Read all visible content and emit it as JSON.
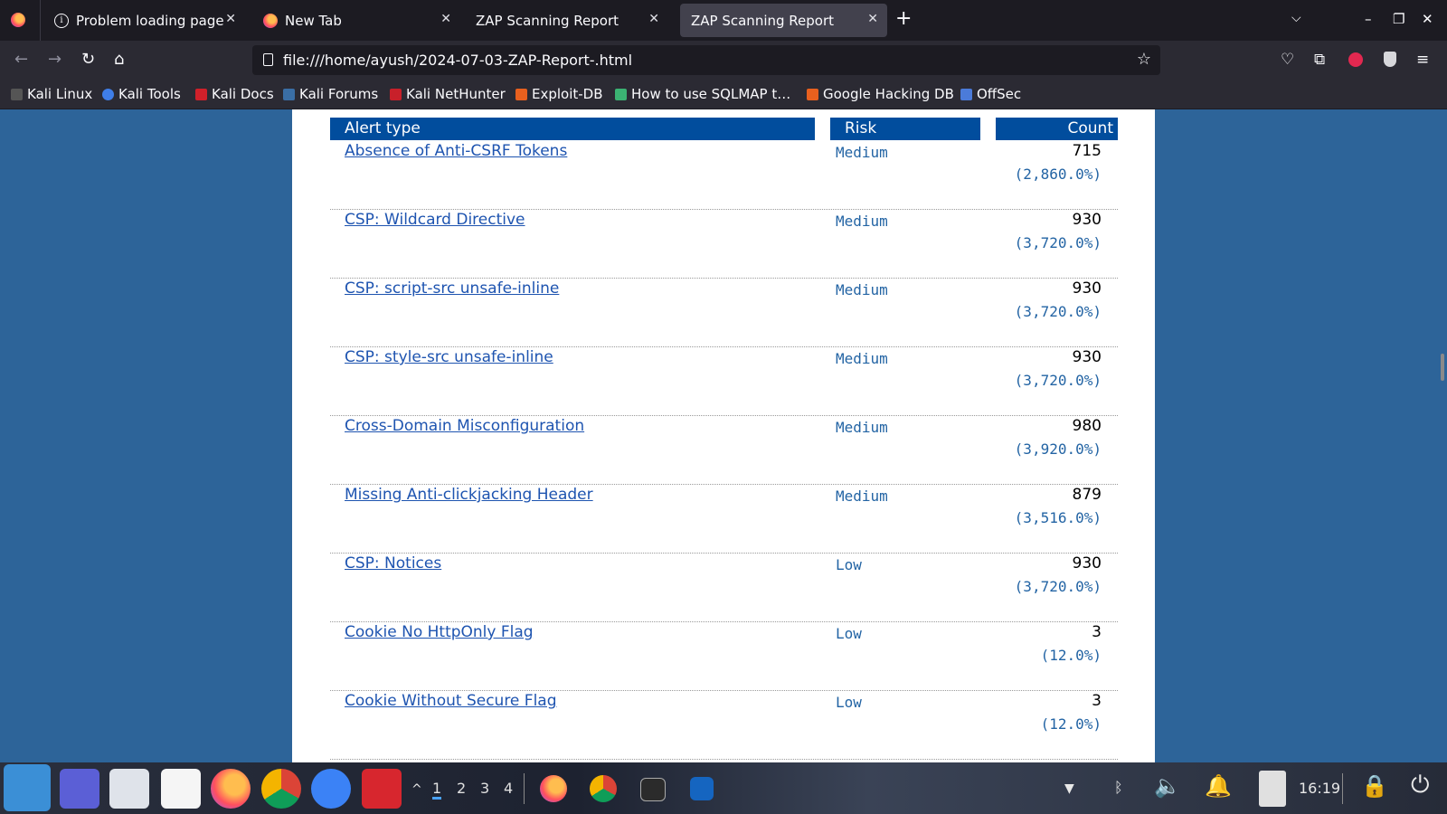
{
  "browser": {
    "tabs": [
      {
        "label": "Problem loading page",
        "icon": "info-icon"
      },
      {
        "label": "New Tab",
        "icon": "firefox-icon"
      },
      {
        "label": "ZAP Scanning Report",
        "icon": "none"
      },
      {
        "label": "ZAP Scanning Report",
        "icon": "none",
        "active": true
      }
    ],
    "url": "file:///home/ayush/2024-07-03-ZAP-Report-.html",
    "bookmarks": [
      {
        "label": "Kali Linux",
        "color": "#2a2a2a"
      },
      {
        "label": "Kali Tools",
        "color": "#3f7ee8"
      },
      {
        "label": "Kali Docs",
        "color": "#d0202a"
      },
      {
        "label": "Kali Forums",
        "color": "#3a6ea5"
      },
      {
        "label": "Kali NetHunter",
        "color": "#c8202a"
      },
      {
        "label": "Exploit-DB",
        "color": "#e8601e"
      },
      {
        "label": "How to use SQLMAP t…",
        "color": "#3bb273"
      },
      {
        "label": "Google Hacking DB",
        "color": "#e8601e"
      },
      {
        "label": "OffSec",
        "color": "#4b7bd9"
      }
    ]
  },
  "table": {
    "headers": {
      "alert_type": "Alert type",
      "risk": "Risk",
      "count": "Count"
    },
    "rows": [
      {
        "alert": "Absence of Anti-CSRF Tokens",
        "risk": "Medium",
        "count": "715",
        "percent": "(2,860.0%)"
      },
      {
        "alert": "CSP: Wildcard Directive",
        "risk": "Medium",
        "count": "930",
        "percent": "(3,720.0%)"
      },
      {
        "alert": "CSP: script-src unsafe-inline",
        "risk": "Medium",
        "count": "930",
        "percent": "(3,720.0%)"
      },
      {
        "alert": "CSP: style-src unsafe-inline",
        "risk": "Medium",
        "count": "930",
        "percent": "(3,720.0%)"
      },
      {
        "alert": "Cross-Domain Misconfiguration",
        "risk": "Medium",
        "count": "980",
        "percent": "(3,920.0%)"
      },
      {
        "alert": "Missing Anti-clickjacking Header",
        "risk": "Medium",
        "count": "879",
        "percent": "(3,516.0%)"
      },
      {
        "alert": "CSP: Notices",
        "risk": "Low",
        "count": "930",
        "percent": "(3,720.0%)"
      },
      {
        "alert": "Cookie No HttpOnly Flag",
        "risk": "Low",
        "count": "3",
        "percent": "(12.0%)"
      },
      {
        "alert": "Cookie Without Secure Flag",
        "risk": "Low",
        "count": "3",
        "percent": "(12.0%)"
      }
    ]
  },
  "taskbar": {
    "workspaces": [
      "1",
      "2",
      "3",
      "4"
    ],
    "clock": "16:19"
  },
  "colors": {
    "header_bg": "#014d9d",
    "link": "#1e54b0",
    "risk_text": "#2364a4",
    "page_bg": "#2d6499"
  }
}
